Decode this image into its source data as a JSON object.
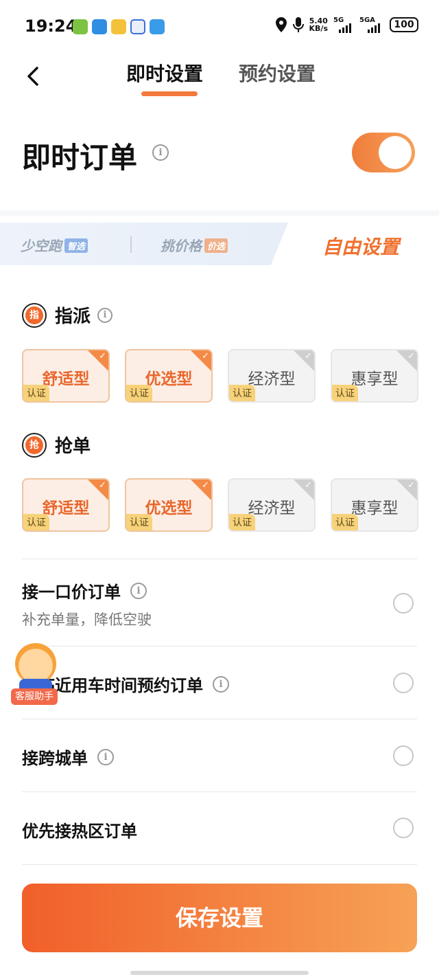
{
  "status_bar": {
    "time": "19:24",
    "speed_value": "5.40",
    "speed_unit": "KB/s",
    "net1": "5G",
    "net2": "5GA",
    "battery": "100"
  },
  "header": {
    "tab_active": "即时设置",
    "tab_inactive": "预约设置"
  },
  "instant": {
    "title": "即时订单",
    "toggle_on": true,
    "accent": "#f37a3c"
  },
  "modes": {
    "mode1": "少空跑",
    "mode1_badge": "智选",
    "mode2": "挑价格",
    "mode2_badge": "价选",
    "mode3": "自由设置"
  },
  "dispatch": {
    "icon_char": "指",
    "title": "指派",
    "cards": [
      {
        "label": "舒适型",
        "tag": "认证",
        "selected": true
      },
      {
        "label": "优选型",
        "tag": "认证",
        "selected": true
      },
      {
        "label": "经济型",
        "tag": "认证",
        "selected": false
      },
      {
        "label": "惠享型",
        "tag": "认证",
        "selected": false
      }
    ]
  },
  "grab": {
    "icon_char": "抢",
    "title": "抢单",
    "cards": [
      {
        "label": "舒适型",
        "tag": "认证",
        "selected": true
      },
      {
        "label": "优选型",
        "tag": "认证",
        "selected": true
      },
      {
        "label": "经济型",
        "tag": "认证",
        "selected": false
      },
      {
        "label": "惠享型",
        "tag": "认证",
        "selected": false
      }
    ]
  },
  "options": [
    {
      "title": "接一口价订单",
      "subtitle": "补充单量，降低空驶",
      "checked": false
    },
    {
      "title": "接临近用车时间预约订单",
      "checked": false
    },
    {
      "title": "接跨城单",
      "checked": false
    },
    {
      "title": "优先接热区订单",
      "checked": false
    }
  ],
  "helper": {
    "label": "客服助手"
  },
  "footer": {
    "save_label": "保存设置"
  }
}
